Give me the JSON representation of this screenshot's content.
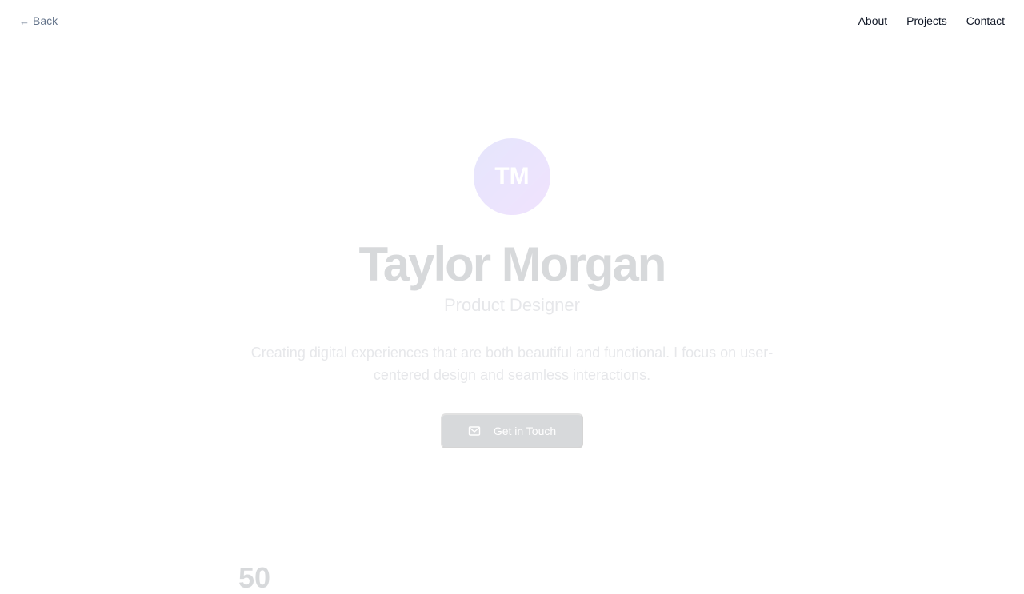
{
  "header": {
    "back_label": "Back",
    "nav": [
      {
        "label": "About"
      },
      {
        "label": "Projects"
      },
      {
        "label": "Contact"
      }
    ]
  },
  "hero": {
    "avatar_initials": "TM",
    "name": "Taylor Morgan",
    "role": "Product Designer",
    "bio": "Creating digital experiences that are both beautiful and functional. I focus on user-centered design and seamless interactions.",
    "cta_label": "Get in Touch",
    "cta_icon": "mail-icon"
  },
  "stats": {
    "first_value_peek": "50"
  },
  "colors": {
    "avatar_gradient_start": "#6366f1",
    "avatar_gradient_end": "#a855f7",
    "cta_background": "#111827",
    "back_link": "#64748b"
  }
}
